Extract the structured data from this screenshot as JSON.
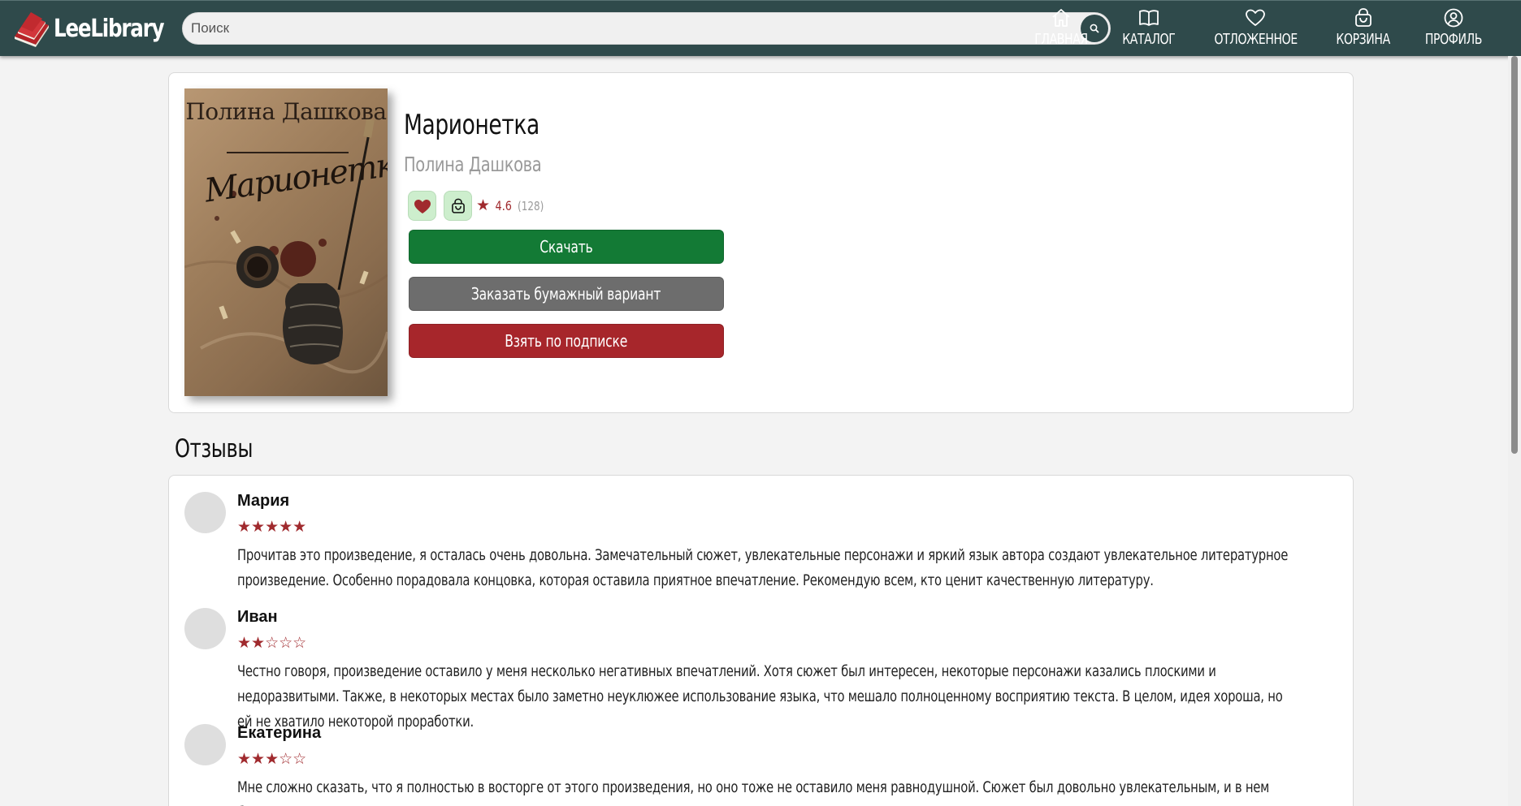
{
  "header": {
    "logo_text": "LeeLibrary",
    "search_placeholder": "Поиск",
    "nav": [
      {
        "label": "ГЛАВНАЯ",
        "icon": "home-icon"
      },
      {
        "label": "КАТАЛОГ",
        "icon": "book-icon"
      },
      {
        "label": "ОТЛОЖЕННОЕ",
        "icon": "heart-icon"
      },
      {
        "label": "КОРЗИНА",
        "icon": "bag-icon"
      },
      {
        "label": "ПРОФИЛЬ",
        "icon": "user-icon"
      }
    ]
  },
  "book": {
    "title": "Марионетка",
    "author": "Полина Дашкова",
    "cover_author": "Полина Дашкова",
    "cover_title": "Марионетка",
    "rating": "4.6",
    "rating_count": "(128)",
    "buttons": {
      "download": "Скачать",
      "order_paper": "Заказать бумажный вариант",
      "subscribe": "Взять по подписке"
    }
  },
  "colors": {
    "header_bg": "#2f4a4b",
    "accent_red": "#a02a2e",
    "download_green": "#137a35",
    "paper_gray": "#6d6d6d",
    "subscribe_red": "#a7262b"
  },
  "reviews": {
    "title": "Отзывы",
    "items": [
      {
        "name": "Мария",
        "stars": "★★★★★",
        "rating": 5,
        "text": "Прочитав это произведение, я осталась очень довольна. Замечательный сюжет, увлекательные персонажи и яркий язык автора создают увлекательное литературное произведение. Особенно порадовала концовка, которая оставила приятное впечатление. Рекомендую всем, кто ценит качественную литературу."
      },
      {
        "name": "Иван",
        "stars": "★★☆☆☆",
        "rating": 2,
        "text": "Честно говоря, произведение оставило у меня несколько негативных впечатлений. Хотя сюжет был интересен, некоторые персонажи казались плоскими и недоразвитыми. Также, в некоторых местах было заметно неуклюжее использование языка, что мешало полноценному восприятию текста. В целом, идея хороша, но ей не хватило некоторой проработки."
      },
      {
        "name": "Екатерина",
        "stars": "★★★☆☆",
        "rating": 3,
        "text": "Мне сложно сказать, что я полностью в восторге от этого произведения, но оно тоже не оставило меня равнодушной. Сюжет был довольно увлекательным, и в нем были свои моменты,"
      }
    ]
  }
}
